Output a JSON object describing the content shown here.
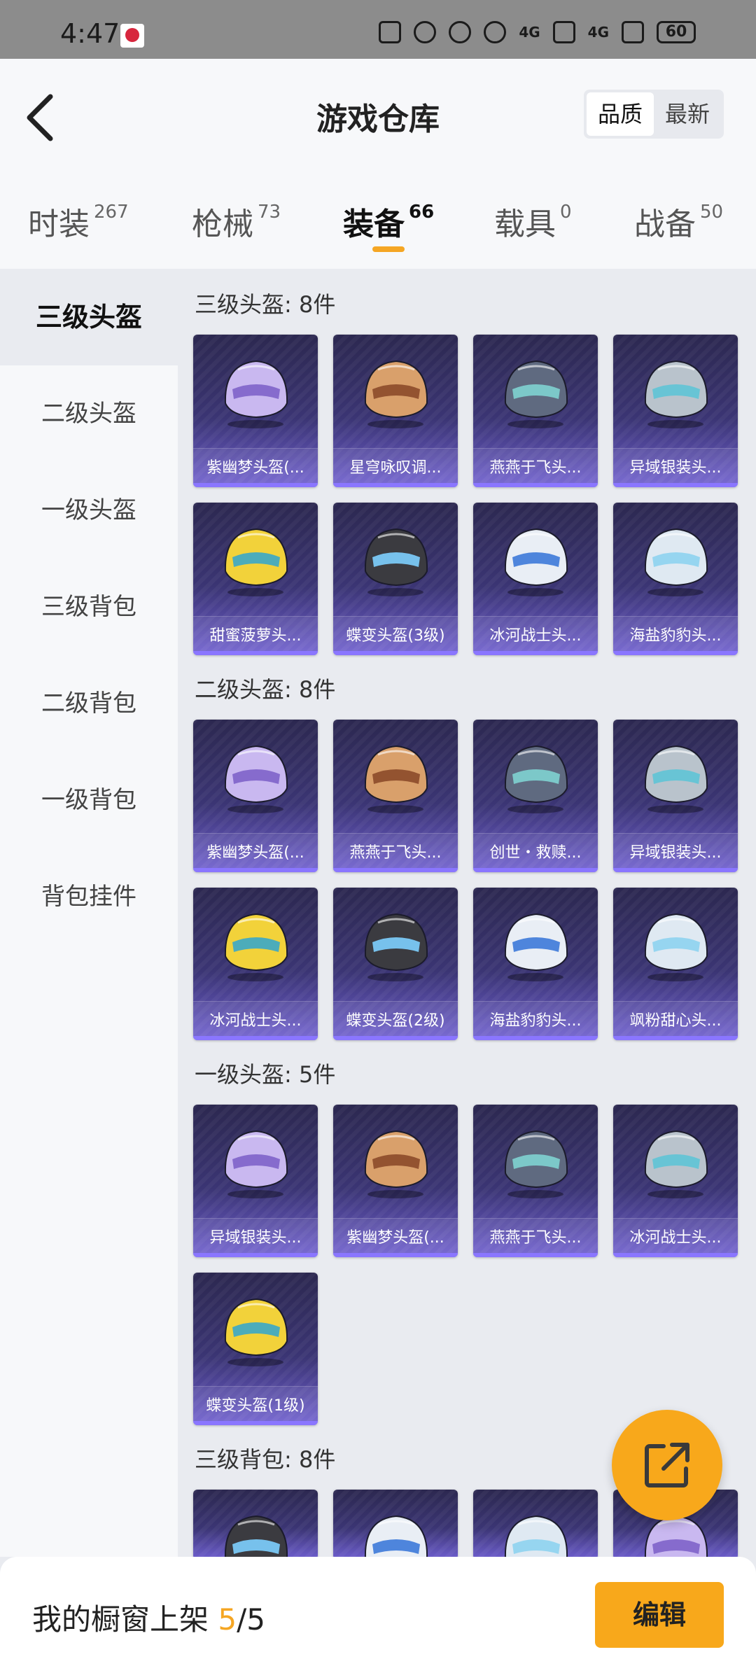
{
  "status_bar": {
    "time": "4:47",
    "signal_1": "4G",
    "signal_2": "4G",
    "battery": "60"
  },
  "header": {
    "title": "游戏仓库",
    "sort_options": [
      "品质",
      "最新"
    ],
    "active_sort": "品质"
  },
  "tabs": [
    {
      "label": "时装",
      "count": "267"
    },
    {
      "label": "枪械",
      "count": "73"
    },
    {
      "label": "装备",
      "count": "66"
    },
    {
      "label": "载具",
      "count": "0"
    },
    {
      "label": "战备",
      "count": "50"
    }
  ],
  "active_tab": "装备",
  "sidebar": {
    "items": [
      "三级头盔",
      "二级头盔",
      "一级头盔",
      "三级背包",
      "二级背包",
      "一级背包",
      "背包挂件"
    ],
    "active": "三级头盔"
  },
  "sections": [
    {
      "title": "三级头盔: 8件",
      "items": [
        {
          "label": "紫幽梦头盔(...",
          "icon": "lavender-helmet-icon"
        },
        {
          "label": "星穹咏叹调...",
          "icon": "ornate-gold-helmet-icon"
        },
        {
          "label": "燕燕于飞头...",
          "icon": "swallow-helmet-icon"
        },
        {
          "label": "异域银装头...",
          "icon": "silver-helmet-icon"
        },
        {
          "label": "甜蜜菠萝头...",
          "icon": "pineapple-helmet-icon"
        },
        {
          "label": "蝶变头盔(3级)",
          "icon": "butterfly-helmet-icon"
        },
        {
          "label": "冰河战士头...",
          "icon": "glacier-helmet-icon"
        },
        {
          "label": "海盐豹豹头...",
          "icon": "seal-helmet-icon"
        }
      ]
    },
    {
      "title": "二级头盔: 8件",
      "items": [
        {
          "label": "紫幽梦头盔(...",
          "icon": "lavender-helmet-icon"
        },
        {
          "label": "燕燕于飞头...",
          "icon": "swallow-helmet-icon"
        },
        {
          "label": "创世・救赎...",
          "icon": "genesis-helmet-icon"
        },
        {
          "label": "异域银装头...",
          "icon": "silver-helmet-icon"
        },
        {
          "label": "冰河战士头...",
          "icon": "glacier-helmet-icon"
        },
        {
          "label": "蝶变头盔(2级)",
          "icon": "butterfly-helmet-icon"
        },
        {
          "label": "海盐豹豹头...",
          "icon": "seal-helmet-icon"
        },
        {
          "label": "飒粉甜心头...",
          "icon": "pink-helmet-icon"
        }
      ]
    },
    {
      "title": "一级头盔: 5件",
      "items": [
        {
          "label": "异域银装头...",
          "icon": "silver-helmet-icon"
        },
        {
          "label": "紫幽梦头盔(...",
          "icon": "lavender-helmet-icon"
        },
        {
          "label": "燕燕于飞头...",
          "icon": "swallow-helmet-icon"
        },
        {
          "label": "冰河战士头...",
          "icon": "glacier-helmet-icon"
        },
        {
          "label": "蝶变头盔(1级)",
          "icon": "butterfly-helmet-icon"
        }
      ]
    },
    {
      "title": "三级背包: 8件",
      "items": []
    }
  ],
  "bottom_bar": {
    "label": "我的橱窗上架",
    "current": "5",
    "separator": "/",
    "total": "5",
    "edit_label": "编辑"
  },
  "colors": {
    "accent": "#f8a81b",
    "card_top": "#2c2850",
    "card_bottom": "#6f5fd0"
  }
}
